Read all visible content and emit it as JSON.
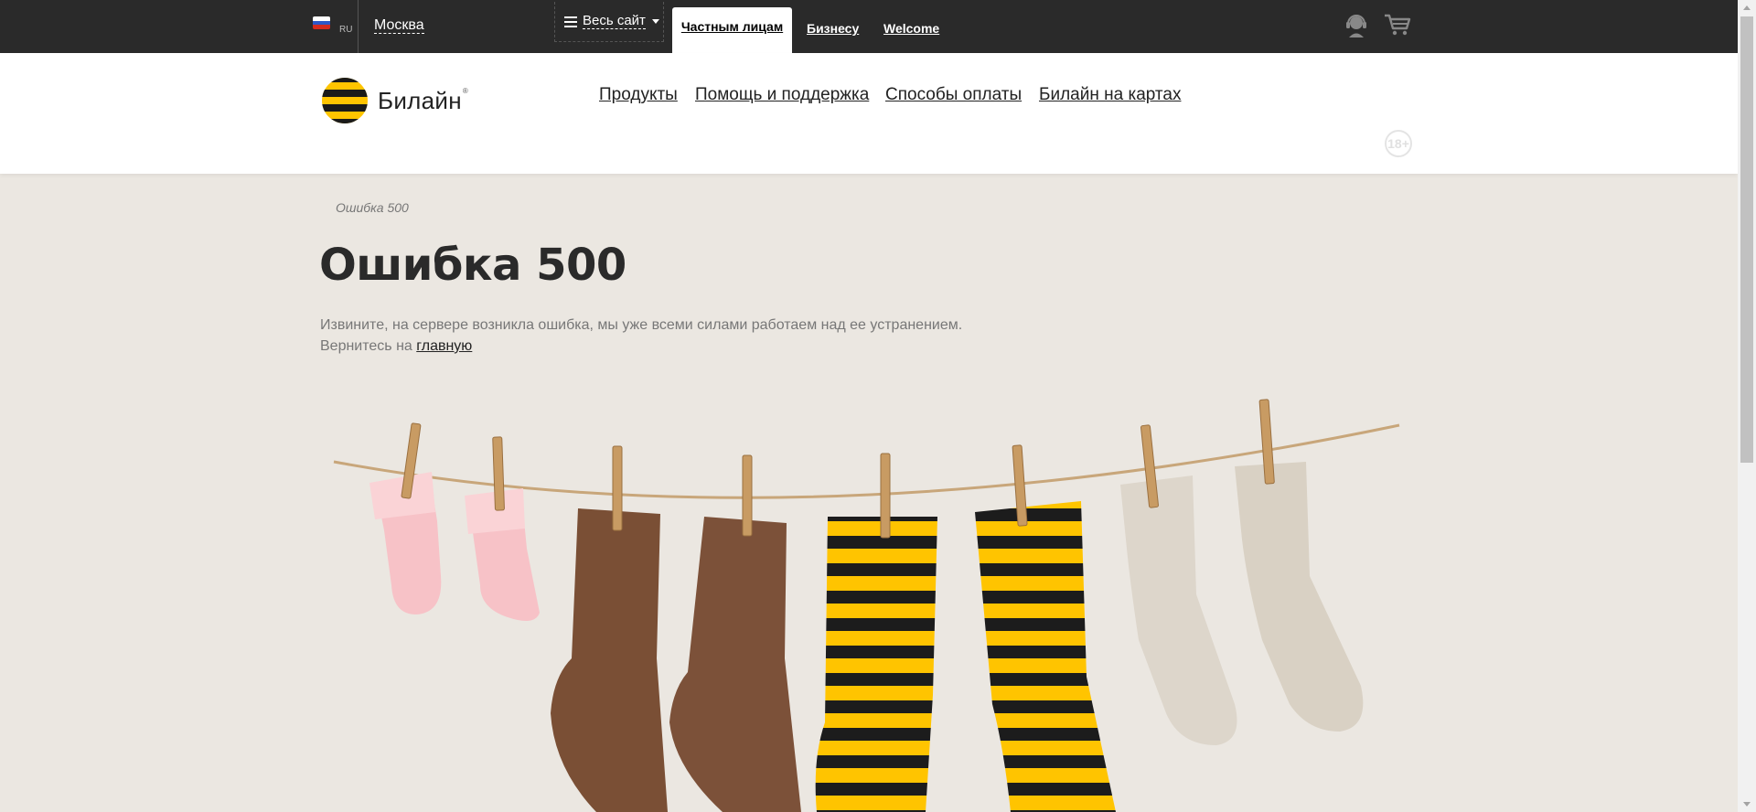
{
  "topbar": {
    "lang_code": "RU",
    "city": "Москва",
    "site_menu_label": "Весь сайт",
    "tabs": [
      {
        "label": "Частным лицам",
        "active": true
      },
      {
        "label": "Бизнесу",
        "active": false
      },
      {
        "label": "Welcome",
        "active": false
      }
    ],
    "icons": [
      "russia-flag-icon",
      "list-icon",
      "caret-down-icon",
      "support-headset-icon",
      "cart-icon"
    ]
  },
  "header": {
    "logo_text": "Билайн",
    "logo_reg": "®",
    "nav": [
      "Продукты",
      "Помощь и поддержка",
      "Способы оплаты",
      "Билайн на картах"
    ],
    "age_rating": "18+"
  },
  "breadcrumb": "Ошибка 500",
  "page": {
    "title": "Ошибка 500",
    "message": "Извините, на сервере возникла ошибка, мы уже всеми силами работаем над ее устранением.",
    "return_prefix": "Вернитесь на ",
    "return_link": "главную"
  },
  "colors": {
    "topbar_bg": "#2a2a2a",
    "page_bg": "#ebe7e1",
    "brand_yellow": "#ffc400",
    "brand_black": "#1a1a1a"
  },
  "illustration": "socks-on-clothesline"
}
